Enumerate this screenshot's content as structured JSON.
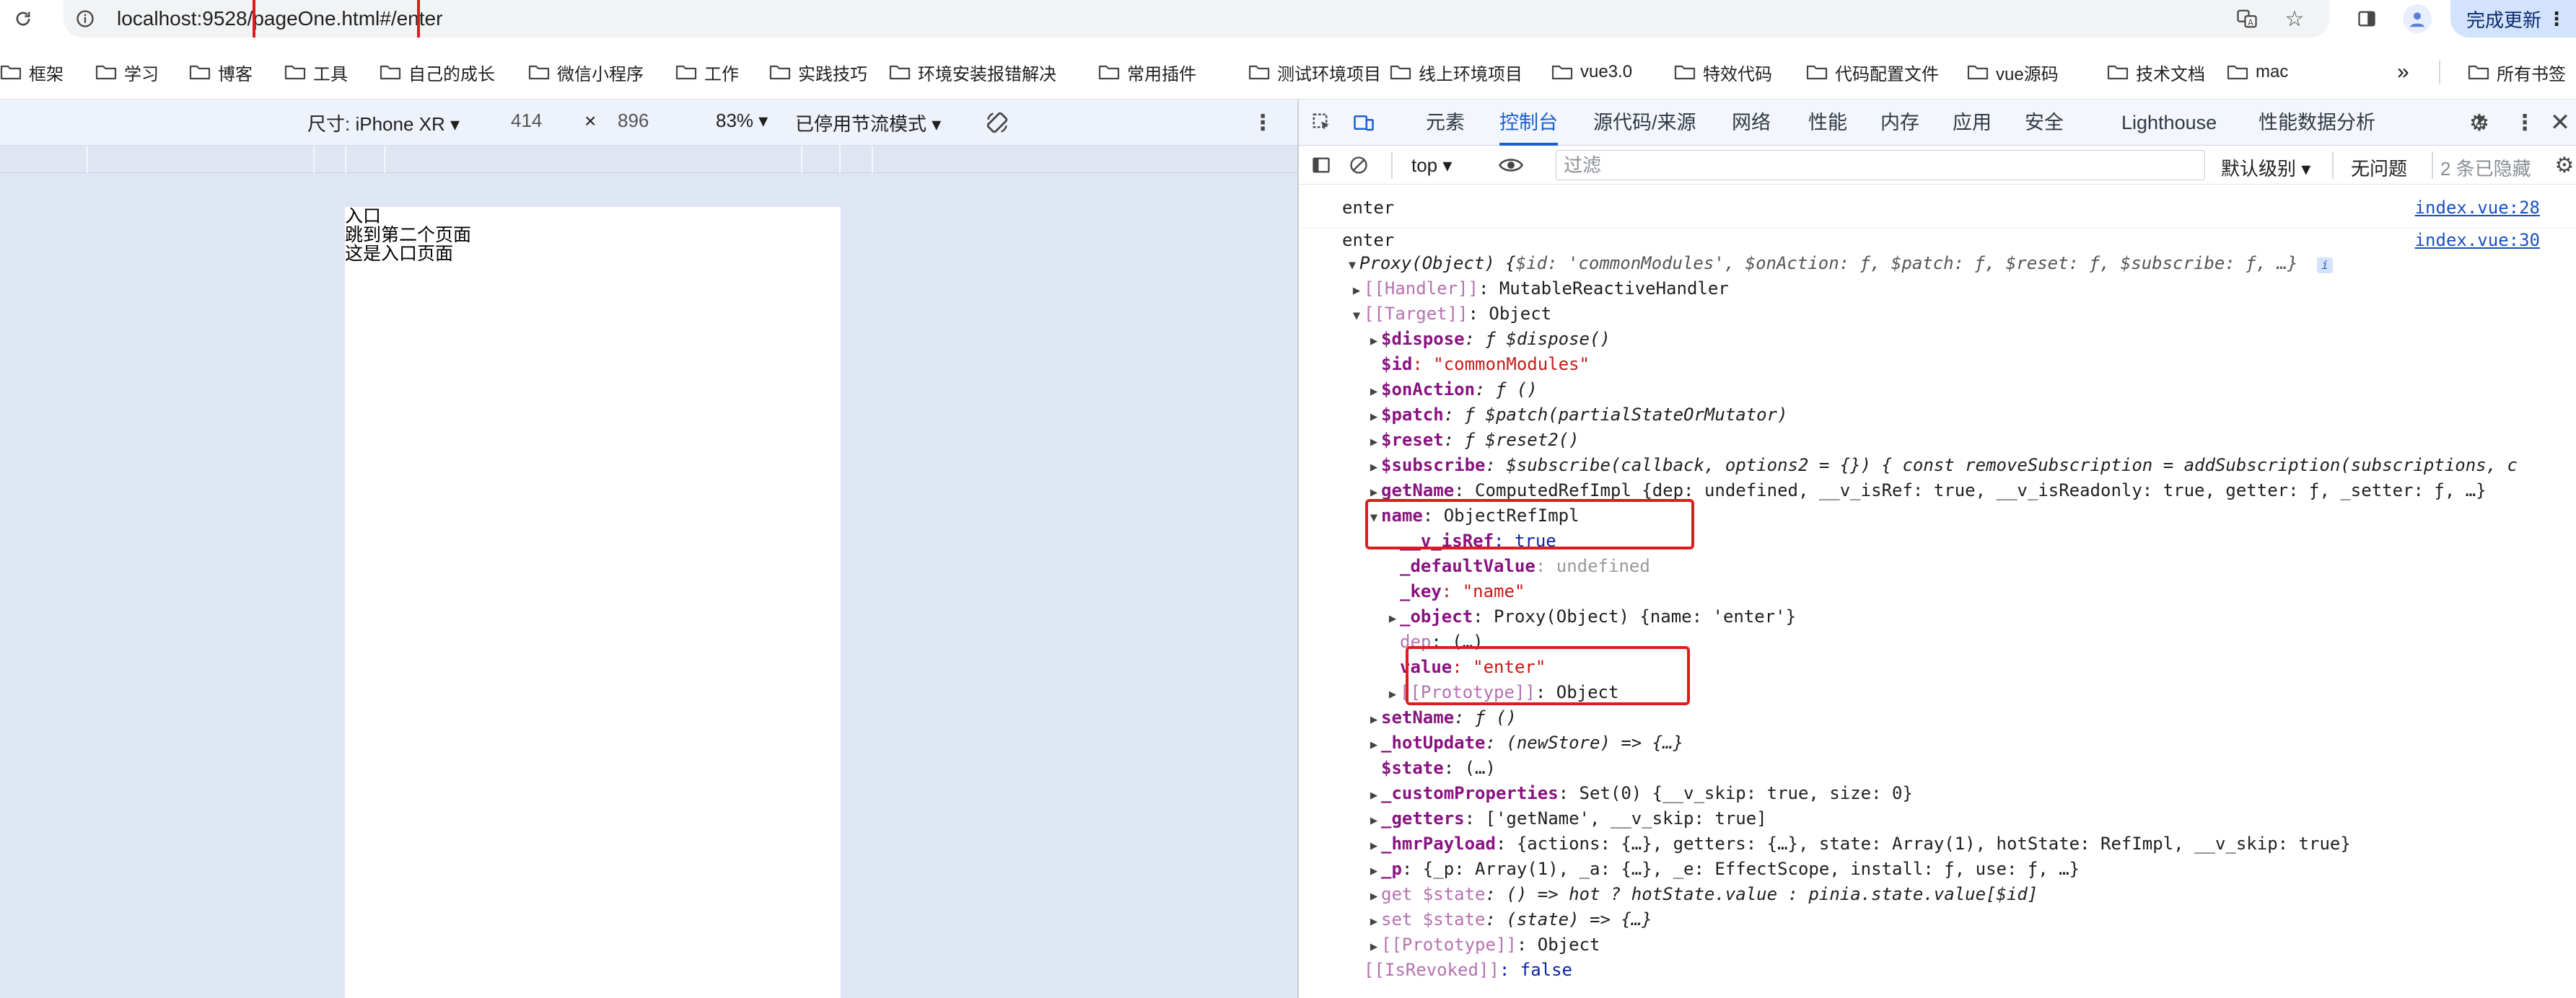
{
  "address_bar": {
    "url_host": "localhost:9528/",
    "url_path_highlight": "pageOne.html#",
    "url_tail": "/enter",
    "update_button": "完成更新"
  },
  "bookmarks": [
    "框架",
    "学习",
    "博客",
    "工具",
    "自己的成长",
    "微信小程序",
    "工作",
    "实践技巧",
    "环境安装报错解决",
    "常用插件",
    "测试环境项目",
    "线上环境项目",
    "vue3.0",
    "特效代码",
    "代码配置文件",
    "vue源码",
    "技术文档",
    "mac"
  ],
  "bookmarks_overflow": "»",
  "all_bookmarks": "所有书签",
  "device_toolbar": {
    "size_label": "尺寸: iPhone XR ▾",
    "width": "414",
    "times": "×",
    "height": "896",
    "zoom": "83% ▾",
    "throttle": "已停用节流模式 ▾"
  },
  "page": {
    "line1": "入口",
    "line2": "跳到第二个页面",
    "line3": "这是入口页面"
  },
  "devtools": {
    "tabs": [
      "元素",
      "控制台",
      "源代码/来源",
      "网络",
      "性能",
      "内存",
      "应用",
      "安全",
      "Lighthouse",
      "性能数据分析"
    ],
    "active_tab": "控制台",
    "context": "top ▾",
    "filter_placeholder": "过滤",
    "level": "默认级别 ▾",
    "issues": "无问题",
    "hidden": "2 条已隐藏"
  },
  "console": {
    "msg1": {
      "text": "enter",
      "source": "index.vue:28"
    },
    "msg2": {
      "text": "enter",
      "source": "index.vue:30"
    },
    "proxy_head_prefix": "Proxy(Object) {",
    "proxy_head_body": "$id: 'commonModules', $onAction: ƒ, $patch: ƒ, $reset: ƒ, $subscribe: ƒ, …}",
    "rows": [
      {
        "indent": 1,
        "tri": "▶",
        "key": "[[Handler]]",
        "val": ": MutableReactiveHandler",
        "style": "dimkey"
      },
      {
        "indent": 1,
        "tri": "▼",
        "key": "[[Target]]",
        "val": ": Object",
        "style": "dimkey"
      },
      {
        "indent": 2,
        "tri": "▶",
        "key": "$dispose",
        "val": ": ƒ $dispose()",
        "style": "fn"
      },
      {
        "indent": 2,
        "tri": "",
        "key": "$id",
        "val": ": \"commonModules\"",
        "style": "str"
      },
      {
        "indent": 2,
        "tri": "▶",
        "key": "$onAction",
        "val": ": ƒ ()",
        "style": "fn"
      },
      {
        "indent": 2,
        "tri": "▶",
        "key": "$patch",
        "val": ": ƒ $patch(partialStateOrMutator)",
        "style": "fn"
      },
      {
        "indent": 2,
        "tri": "▶",
        "key": "$reset",
        "val": ": ƒ $reset2()",
        "style": "fn"
      },
      {
        "indent": 2,
        "tri": "▶",
        "key": "$subscribe",
        "val": ": $subscribe(callback, options2 = {}) { const removeSubscription = addSubscription(subscriptions, c",
        "style": "fn"
      },
      {
        "indent": 2,
        "tri": "▶",
        "key": "getName",
        "val": ": ComputedRefImpl {dep: undefined, __v_isRef: true, __v_isReadonly: true, getter: ƒ, _setter: ƒ, …}",
        "style": "plain"
      },
      {
        "indent": 2,
        "tri": "▼",
        "key": "name",
        "val": ": ObjectRefImpl",
        "style": "plain"
      },
      {
        "indent": 3,
        "tri": "",
        "key": "__v_isRef",
        "val": ": true",
        "style": "bool"
      },
      {
        "indent": 3,
        "tri": "",
        "key": "_defaultValue",
        "val": ": undefined",
        "style": "dim"
      },
      {
        "indent": 3,
        "tri": "",
        "key": "_key",
        "val": ": \"name\"",
        "style": "str"
      },
      {
        "indent": 3,
        "tri": "▶",
        "key": "_object",
        "val": ": Proxy(Object) {name: 'enter'}",
        "style": "plain"
      },
      {
        "indent": 3,
        "tri": "",
        "key": "dep",
        "val": ": (…)",
        "style": "dimkey"
      },
      {
        "indent": 3,
        "tri": "",
        "key": "value",
        "val": ": \"enter\"",
        "style": "strkey"
      },
      {
        "indent": 3,
        "tri": "▶",
        "key": "[[Prototype]]",
        "val": ": Object",
        "style": "dimkey"
      },
      {
        "indent": 2,
        "tri": "▶",
        "key": "setName",
        "val": ": ƒ ()",
        "style": "fn"
      },
      {
        "indent": 2,
        "tri": "▶",
        "key": "_hotUpdate",
        "val": ": (newStore) => {…}",
        "style": "fn"
      },
      {
        "indent": 2,
        "tri": "",
        "key": "$state",
        "val": ": (…)",
        "style": "plain"
      },
      {
        "indent": 2,
        "tri": "▶",
        "key": "_customProperties",
        "val": ": Set(0) {__v_skip: true, size: 0}",
        "style": "plain"
      },
      {
        "indent": 2,
        "tri": "▶",
        "key": "_getters",
        "val": ": ['getName', __v_skip: true]",
        "style": "plain"
      },
      {
        "indent": 2,
        "tri": "▶",
        "key": "_hmrPayload",
        "val": ": {actions: {…}, getters: {…}, state: Array(1), hotState: RefImpl, __v_skip: true}",
        "style": "plain"
      },
      {
        "indent": 2,
        "tri": "▶",
        "key": "_p",
        "val": ": {_p: Array(1), _a: {…}, _e: EffectScope, install: ƒ, use: ƒ, …}",
        "style": "plain"
      },
      {
        "indent": 2,
        "tri": "▶",
        "key": "get $state",
        "val": ": () => hot ? hotState.value : pinia.state.value[$id]",
        "style": "fnDim"
      },
      {
        "indent": 2,
        "tri": "▶",
        "key": "set $state",
        "val": ": (state) => {…}",
        "style": "fnDim"
      },
      {
        "indent": 2,
        "tri": "▶",
        "key": "[[Prototype]]",
        "val": ": Object",
        "style": "plainNoBold"
      },
      {
        "indent": 1,
        "tri": "",
        "key": "[[IsRevoked]]",
        "val": ": false",
        "style": "dimBool"
      }
    ]
  },
  "colors": {
    "accent": "#1a5fd1",
    "highlight_box": "#e01b1b"
  }
}
